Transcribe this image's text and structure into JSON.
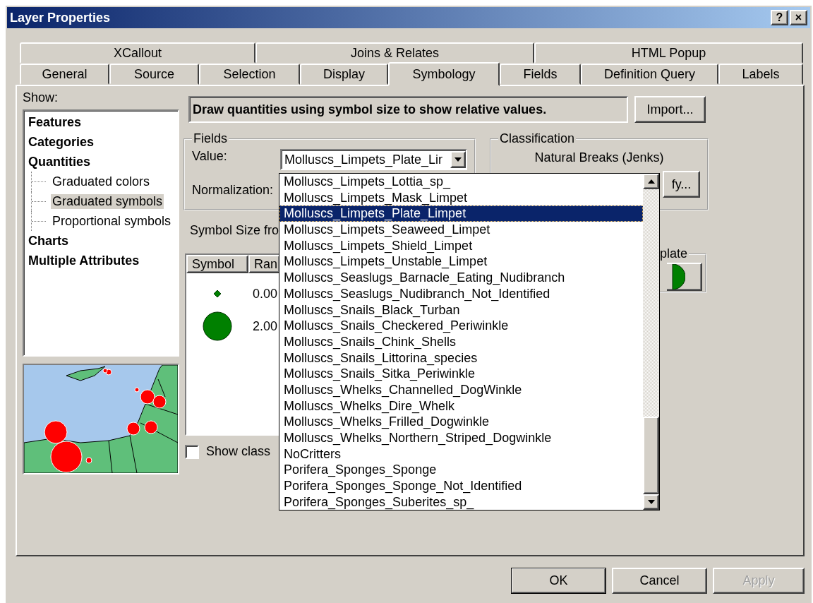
{
  "window": {
    "title": "Layer Properties",
    "title_buttons": [
      "?",
      "×"
    ]
  },
  "tab_rows": [
    {
      "tabs": [
        {
          "label": "XCallout",
          "selected": false
        },
        {
          "label": "Joins & Relates",
          "selected": false
        },
        {
          "label": "HTML Popup",
          "selected": false
        }
      ]
    },
    {
      "tabs": [
        {
          "label": "General",
          "selected": false
        },
        {
          "label": "Source",
          "selected": false
        },
        {
          "label": "Selection",
          "selected": false
        },
        {
          "label": "Display",
          "selected": false
        },
        {
          "label": "Symbology",
          "selected": true
        },
        {
          "label": "Fields",
          "selected": false
        },
        {
          "label": "Definition Query",
          "selected": false
        },
        {
          "label": "Labels",
          "selected": false
        }
      ]
    }
  ],
  "show": {
    "label": "Show:",
    "items": [
      {
        "label": "Features",
        "selected": false
      },
      {
        "label": "Categories",
        "selected": false
      },
      {
        "label": "Quantities",
        "selected": false,
        "children": [
          {
            "label": "Graduated colors",
            "selected": false
          },
          {
            "label": "Graduated symbols",
            "selected": true
          },
          {
            "label": "Proportional symbols",
            "selected": false
          }
        ]
      },
      {
        "label": "Charts",
        "selected": false
      },
      {
        "label": "Multiple Attributes",
        "selected": false
      }
    ]
  },
  "description": "Draw quantities using symbol size to show relative values.",
  "import_button": "Import...",
  "fields": {
    "title": "Fields",
    "value_label": "Value:",
    "value": "Molluscs_Limpets_Plate_Lir",
    "normalization_label": "Normalization:"
  },
  "classification": {
    "title": "Classification",
    "method": "Natural Breaks (Jenks)",
    "button": "fy..."
  },
  "symbol_size_label": "Symbol Size fro",
  "table": {
    "columns": [
      "Symbol",
      "Ran"
    ],
    "rows": [
      {
        "kind": "small",
        "range": "0.00"
      },
      {
        "kind": "large",
        "range": "2.00"
      }
    ]
  },
  "template": {
    "title": "plate"
  },
  "show_class": {
    "label": "Show class",
    "checked": false
  },
  "dropdown": {
    "items": [
      {
        "label": "Molluscs_Limpets_Lottia_sp_",
        "selected": false
      },
      {
        "label": "Molluscs_Limpets_Mask_Limpet",
        "selected": false
      },
      {
        "label": "Molluscs_Limpets_Plate_Limpet",
        "selected": true
      },
      {
        "label": "Molluscs_Limpets_Seaweed_Limpet",
        "selected": false
      },
      {
        "label": "Molluscs_Limpets_Shield_Limpet",
        "selected": false
      },
      {
        "label": "Molluscs_Limpets_Unstable_Limpet",
        "selected": false
      },
      {
        "label": "Molluscs_Seaslugs_Barnacle_Eating_Nudibranch",
        "selected": false
      },
      {
        "label": "Molluscs_Seaslugs_Nudibranch_Not_Identified",
        "selected": false
      },
      {
        "label": "Molluscs_Snails_Black_Turban",
        "selected": false
      },
      {
        "label": "Molluscs_Snails_Checkered_Periwinkle",
        "selected": false
      },
      {
        "label": "Molluscs_Snails_Chink_Shells",
        "selected": false
      },
      {
        "label": "Molluscs_Snails_Littorina_species",
        "selected": false
      },
      {
        "label": "Molluscs_Snails_Sitka_Periwinkle",
        "selected": false
      },
      {
        "label": "Molluscs_Whelks_Channelled_DogWinkle",
        "selected": false
      },
      {
        "label": "Molluscs_Whelks_Dire_Whelk",
        "selected": false
      },
      {
        "label": "Molluscs_Whelks_Frilled_Dogwinkle",
        "selected": false
      },
      {
        "label": "Molluscs_Whelks_Northern_Striped_Dogwinkle",
        "selected": false
      },
      {
        "label": "NoCritters",
        "selected": false
      },
      {
        "label": "Porifera_Sponges_Sponge",
        "selected": false
      },
      {
        "label": "Porifera_Sponges_Sponge_Not_Identified",
        "selected": false
      },
      {
        "label": "Porifera_Sponges_Suberites_sp_",
        "selected": false
      }
    ]
  },
  "buttons": [
    {
      "label": "OK",
      "default": true,
      "disabled": false
    },
    {
      "label": "Cancel",
      "default": false,
      "disabled": false
    },
    {
      "label": "Apply",
      "default": false,
      "disabled": true
    }
  ]
}
